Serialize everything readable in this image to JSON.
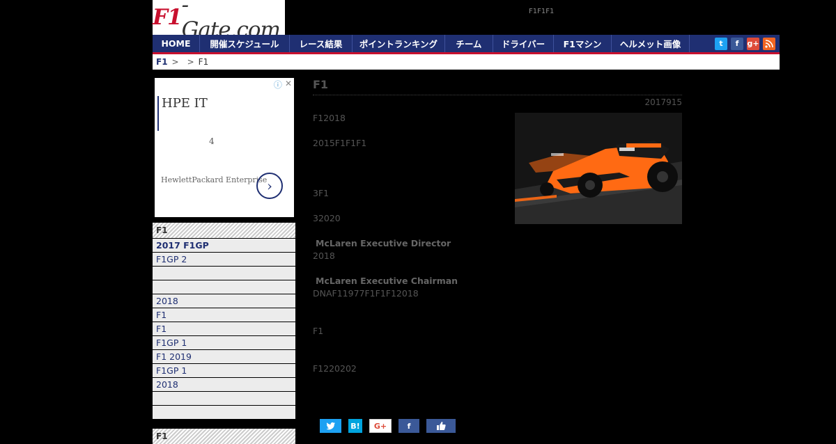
{
  "header": {
    "logo_f1": "F1",
    "logo_rest": "-Gate.com",
    "tagline": "F1F1F1"
  },
  "nav": {
    "items": [
      "HOME",
      "開催スケジュール",
      "レース結果",
      "ポイントランキング",
      "チーム",
      "ドライバー",
      "F1マシン",
      "ヘルメット画像"
    ],
    "social": [
      "twitter-icon",
      "facebook-icon",
      "googleplus-icon",
      "rss-icon"
    ]
  },
  "breadcrumb": {
    "home": "F1",
    "sep1": ">",
    "sep2": ">",
    "current": "F1"
  },
  "ad": {
    "title": "HPE IT",
    "number": "4",
    "brand": "HewlettPackard Enterprise"
  },
  "sidebar": {
    "heading": "F1",
    "items": [
      "2017 F1GP",
      "F1GP 2",
      "",
      "",
      "2018",
      "F1",
      "F1",
      " F1GP 1",
      "F1 2019",
      "F1GP 1",
      " 2018",
      "",
      ""
    ],
    "heading2": "F1"
  },
  "article": {
    "title": "F1",
    "date": "2017915",
    "p1": "F12018",
    "p2": "2015F1F1F1",
    "p3": "3F1",
    "p4": "32020",
    "sub1": "McLaren Executive Director",
    "p5": "2018",
    "sub2": "McLaren Executive Chairman",
    "p6": "DNAF11977F1F1F12018",
    "p7": "F1",
    "p8": "F1220202"
  },
  "share": {
    "twitter": "",
    "hatena": "B!",
    "googleplus": "G+",
    "facebook": "f",
    "like": ""
  },
  "colors": {
    "nav": "#1f2f72",
    "accent": "#c8102e",
    "papaya": "#ff6a13"
  }
}
